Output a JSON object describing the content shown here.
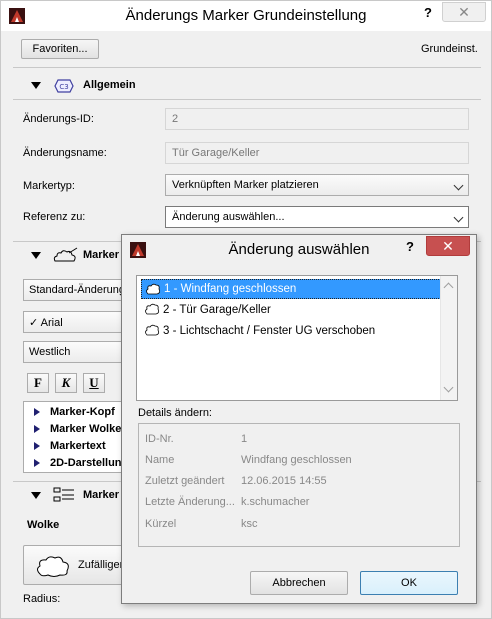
{
  "main": {
    "title": "Änderungs Marker Grundeinstellung",
    "help": "?",
    "close": "✕",
    "favorites_button": "Favoriten...",
    "grundeinst_label": "Grundeinst.",
    "general": {
      "header": "Allgemein",
      "id_label": "Änderungs-ID:",
      "id_value": "2",
      "name_label": "Änderungsname:",
      "name_value": "Tür Garage/Keller",
      "markertype_label": "Markertyp:",
      "markertype_value": "Verknüpften Marker platzieren",
      "reference_label": "Referenz zu:",
      "reference_value": "Änderung auswählen..."
    },
    "marker_section": {
      "header": "Marker",
      "standard_value": "Standard-Änderung",
      "font_value": "✓ Arial",
      "script_value": "Westlich",
      "bold": "F",
      "italic": "K",
      "underline": "U",
      "tree": [
        "Marker-Kopf",
        "Marker Wolke",
        "Markertext",
        "2D-Darstellung"
      ]
    },
    "marker_section2": {
      "header": "Marker",
      "wolke_label": "Wolke",
      "random_button": "Zufälliger",
      "radius_label": "Radius:"
    }
  },
  "dialog": {
    "title": "Änderung auswählen",
    "help": "?",
    "close": "✕",
    "items": [
      "1 - Windfang geschlossen",
      "2 - Tür Garage/Keller",
      "3 - Lichtschacht / Fenster UG verschoben"
    ],
    "details_label": "Details ändern:",
    "details": [
      {
        "key": "ID-Nr.",
        "value": "1"
      },
      {
        "key": "Name",
        "value": "Windfang geschlossen"
      },
      {
        "key": "Zuletzt geändert",
        "value": "12.06.2015 14:55"
      },
      {
        "key": "Letzte Änderung...",
        "value": "k.schumacher"
      },
      {
        "key": "Kürzel",
        "value": "ksc"
      }
    ],
    "cancel_button": "Abbrechen",
    "ok_button": "OK"
  },
  "colors": {
    "selection": "#3399ff",
    "close_red": "#c75050",
    "background": "#f0f0f0"
  }
}
